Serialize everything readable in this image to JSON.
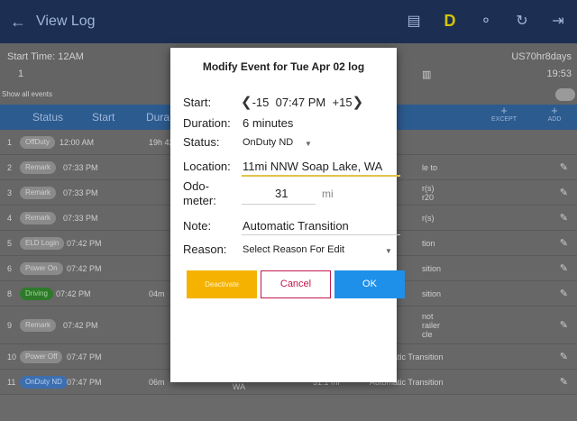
{
  "appbar": {
    "title": "View Log",
    "icons": [
      "back-arrow-icon",
      "message-icon",
      "d-status-icon",
      "eld-connection-icon",
      "refresh-icon",
      "logout-icon"
    ],
    "d_label": "D"
  },
  "info": {
    "start_time": "Start Time: 12AM",
    "count": "1",
    "cycle": "US70hr8days",
    "time": "19:53",
    "show_all": "Show all events"
  },
  "table": {
    "headers": {
      "status": "Status",
      "start": "Start",
      "duration": "Dura",
      "except": "EXCEPT",
      "add": "ADD"
    },
    "rows": [
      {
        "num": "1",
        "status": "OffDuty",
        "start": "12:00 AM",
        "dur": "19h 42",
        "text": "",
        "loc": "",
        "odo": ""
      },
      {
        "num": "2",
        "status": "Remark",
        "start": "07:33 PM",
        "dur": "",
        "text": "le to",
        "loc": "",
        "odo": ""
      },
      {
        "num": "3",
        "status": "Remark",
        "start": "07:33 PM",
        "dur": "",
        "text": "r(s)\nr20",
        "loc": "",
        "odo": ""
      },
      {
        "num": "4",
        "status": "Remark",
        "start": "07:33 PM",
        "dur": "",
        "text": "r(s)",
        "loc": "",
        "odo": ""
      },
      {
        "num": "5",
        "status": "ELD Login",
        "start": "07:42 PM",
        "dur": "",
        "text": "tion",
        "loc": "",
        "odo": ""
      },
      {
        "num": "6",
        "status": "Power On",
        "start": "07:42 PM",
        "dur": "",
        "text": "sition",
        "loc": "",
        "odo": ""
      },
      {
        "num": "8",
        "status": "Driving",
        "start": "07:42 PM",
        "dur": "04m",
        "text": "sition",
        "loc": "",
        "odo": ""
      },
      {
        "num": "9",
        "status": "Remark",
        "start": "07:42 PM",
        "dur": "",
        "text": "not\nrailer\ncle",
        "loc": "",
        "odo": ""
      },
      {
        "num": "10",
        "status": "Power Off",
        "start": "07:47 PM",
        "dur": "",
        "text": "Automatic Transition",
        "loc": "11mi NNW Soap Lake,\nWA",
        "odo": "31.1 mi"
      },
      {
        "num": "11",
        "status": "OnDuty ND",
        "start": "07:47 PM",
        "dur": "06m",
        "text": "Automatic Transition",
        "loc": "11mi NNW Soap Lake,\nWA",
        "odo": "31.1 mi"
      }
    ]
  },
  "dialog": {
    "title": "Modify Event for Tue Apr 02 log",
    "start_label": "Start:",
    "minus_label": "-15",
    "start_time": "07:47 PM",
    "plus_label": "+15",
    "duration_label": "Duration:",
    "duration_value": "6 minutes",
    "status_label": "Status:",
    "status_value": "OnDuty ND",
    "location_label": "Location:",
    "location_value": "11mi NNW Soap Lake, WA",
    "odometer_label_1": "Odo-",
    "odometer_label_2": "meter:",
    "odometer_value": "31",
    "odometer_unit": "mi",
    "note_label": "Note:",
    "note_value": "Automatic Transition",
    "reason_label": "Reason:",
    "reason_value": "Select Reason For Edit",
    "deactivate_label": "Deactivate",
    "cancel_label": "Cancel",
    "ok_label": "OK"
  }
}
